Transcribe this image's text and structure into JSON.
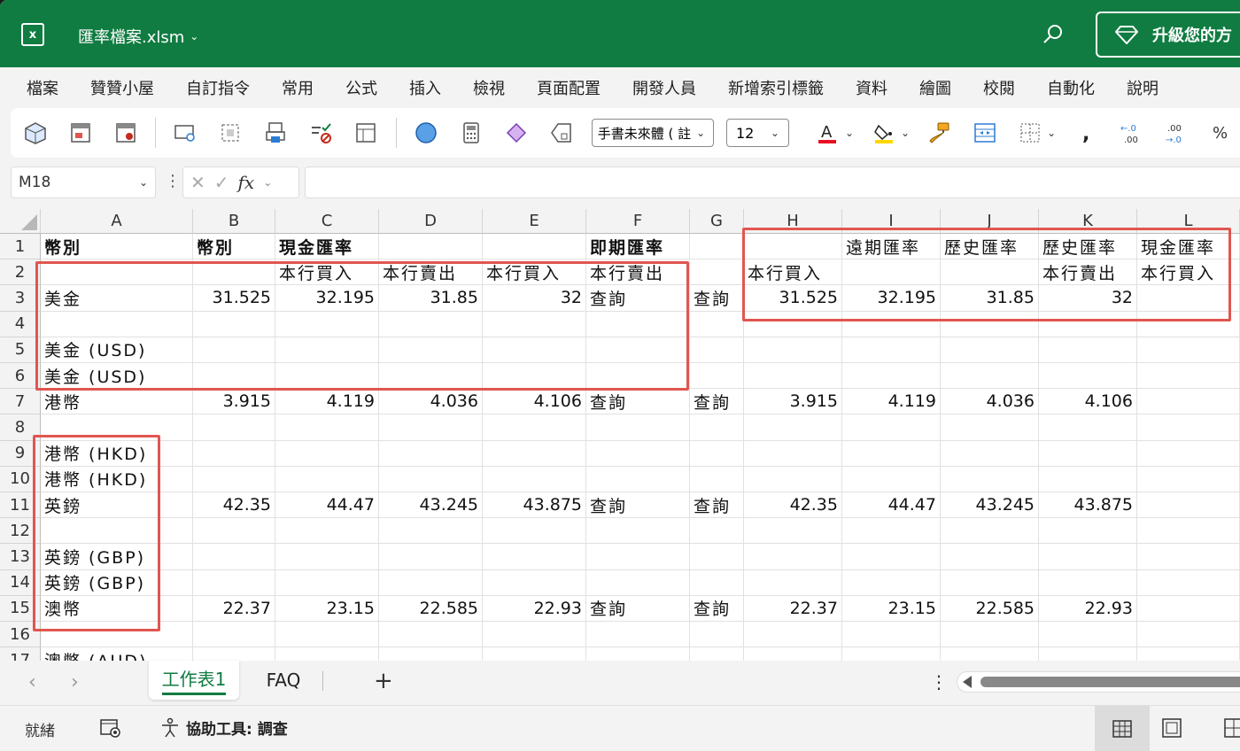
{
  "titlebar": {
    "app_icon": "excel-icon",
    "filename": "匯率檔案.xlsm",
    "upgrade_label": "升級您的方"
  },
  "menu": [
    "檔案",
    "贊贊小屋",
    "自訂指令",
    "常用",
    "公式",
    "插入",
    "檢視",
    "頁面配置",
    "開發人員",
    "新增索引標籤",
    "資料",
    "繪圖",
    "校閱",
    "自動化",
    "說明"
  ],
  "ribbon": {
    "font_name": "手書未來體 ( 註",
    "font_size": "12",
    "font_color": "#e81123",
    "fill_color": "#ffd700"
  },
  "formula_bar": {
    "name_box": "M18",
    "fx": "fx",
    "formula": ""
  },
  "sheet": {
    "columns": [
      "A",
      "B",
      "C",
      "D",
      "E",
      "F",
      "G",
      "H",
      "I",
      "J",
      "K",
      "L"
    ],
    "rows": [
      "1",
      "2",
      "3",
      "4",
      "5",
      "6",
      "7",
      "8",
      "9",
      "10",
      "11",
      "12",
      "13",
      "14",
      "15",
      "16",
      "17"
    ],
    "cells": {
      "A1": "幣別",
      "B1": "幣別",
      "C1": "現金匯率",
      "F1": "即期匯率",
      "I1": "遠期匯率",
      "J1": "歷史匯率",
      "K1": "歷史匯率",
      "L1": "現金匯率",
      "C2": "本行買入",
      "D2": "本行賣出",
      "E2": "本行買入",
      "F2": "本行賣出",
      "H2": "本行買入",
      "K2": "本行賣出",
      "L2": "本行買入",
      "A3": "美金",
      "B3": "31.525",
      "C3": "32.195",
      "D3": "31.85",
      "E3": "32",
      "F3": "查詢",
      "G3": "查詢",
      "H3": "31.525",
      "I3": "32.195",
      "J3": "31.85",
      "K3": "32",
      "A5": "美金 (USD)",
      "A6": "美金 (USD)",
      "A7": "港幣",
      "B7": "3.915",
      "C7": "4.119",
      "D7": "4.036",
      "E7": "4.106",
      "F7": "查詢",
      "G7": "查詢",
      "H7": "3.915",
      "I7": "4.119",
      "J7": "4.036",
      "K7": "4.106",
      "A9": "港幣 (HKD)",
      "A10": "港幣 (HKD)",
      "A11": "英鎊",
      "B11": "42.35",
      "C11": "44.47",
      "D11": "43.245",
      "E11": "43.875",
      "F11": "查詢",
      "G11": "查詢",
      "H11": "42.35",
      "I11": "44.47",
      "J11": "43.245",
      "K11": "43.875",
      "A13": "英鎊 (GBP)",
      "A14": "英鎊 (GBP)",
      "A15": "澳幣",
      "B15": "22.37",
      "C15": "23.15",
      "D15": "22.585",
      "E15": "22.93",
      "F15": "查詢",
      "G15": "查詢",
      "H15": "22.37",
      "I15": "23.15",
      "J15": "22.585",
      "K15": "22.93",
      "A17": "澳幣 (AUD)"
    },
    "highlight_color": "#e0564f"
  },
  "tabs": {
    "sheets": [
      "工作表1",
      "FAQ"
    ],
    "active": "工作表1",
    "add_label": "+"
  },
  "status": {
    "ready": "就緒",
    "accessibility": "協助工具: 調查"
  }
}
